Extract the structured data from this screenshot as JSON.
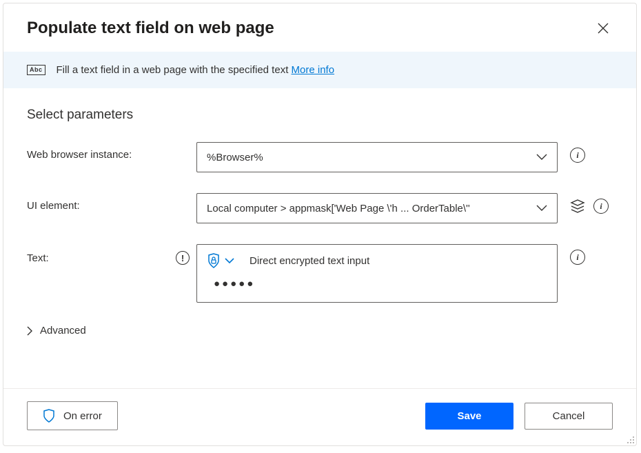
{
  "header": {
    "title": "Populate text field on web page"
  },
  "banner": {
    "icon_label": "Abc",
    "text": "Fill a text field in a web page with the specified text ",
    "more_info": "More info"
  },
  "section": {
    "title": "Select parameters"
  },
  "fields": {
    "browser": {
      "label": "Web browser instance:",
      "value": "%Browser%"
    },
    "ui_element": {
      "label": "UI element:",
      "value": "Local computer > appmask['Web Page \\'h ... OrderTable\\''"
    },
    "text": {
      "label": "Text:",
      "mode_label": "Direct encrypted text input",
      "masked_value": "●●●●●"
    }
  },
  "advanced": {
    "label": "Advanced"
  },
  "footer": {
    "on_error": "On error",
    "save": "Save",
    "cancel": "Cancel"
  }
}
